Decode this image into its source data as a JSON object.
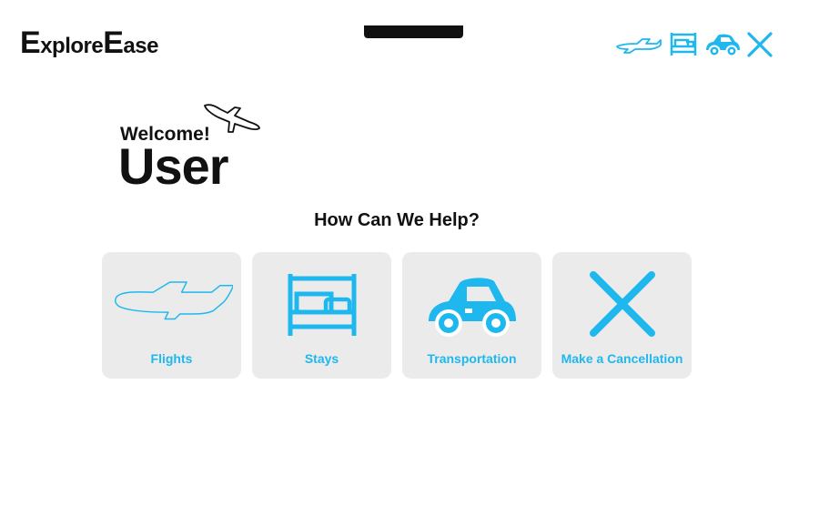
{
  "app": {
    "logo_prefix_cap": "E",
    "logo_prefix_rest": "xplore",
    "logo_suffix_cap": "E",
    "logo_suffix_rest": "ase"
  },
  "header": {
    "nav_icons": [
      "plane-icon",
      "bed-icon",
      "car-icon",
      "close-icon"
    ]
  },
  "greeting": {
    "welcome": "Welcome!",
    "user_name": "User"
  },
  "help": {
    "heading": "How Can We Help?"
  },
  "cards": [
    {
      "label": "Flights",
      "icon": "plane-icon"
    },
    {
      "label": "Stays",
      "icon": "bed-icon"
    },
    {
      "label": "Transportation",
      "icon": "car-icon"
    },
    {
      "label": "Make a Cancellation",
      "icon": "close-icon"
    }
  ],
  "colors": {
    "accent": "#1fb8ee",
    "card_bg": "#ebebeb",
    "text": "#111111"
  }
}
